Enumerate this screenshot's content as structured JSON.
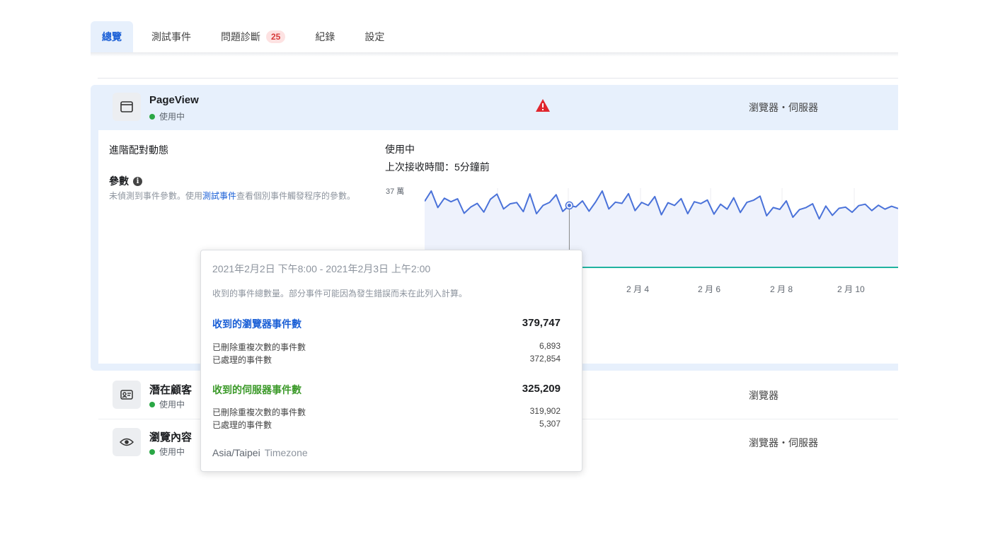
{
  "tabs": [
    {
      "label": "總覽",
      "active": true
    },
    {
      "label": "測試事件",
      "active": false
    },
    {
      "label": "問題診斷",
      "active": false,
      "badge": "25"
    },
    {
      "label": "紀錄",
      "active": false
    },
    {
      "label": "設定",
      "active": false
    }
  ],
  "events": [
    {
      "name": "PageView",
      "status": "使用中",
      "sources": "瀏覽器・伺服器",
      "icon": "browser-window-icon",
      "warning": true
    },
    {
      "name": "潛在顧客",
      "status": "使用中",
      "sources": "瀏覽器",
      "icon": "contact-card-icon"
    },
    {
      "name": "瀏覽內容",
      "status": "使用中",
      "sources": "瀏覽器・伺服器",
      "icon": "eye-icon"
    }
  ],
  "details": {
    "matching_label": "進階配對動態",
    "params_label": "參數",
    "params_desc_prefix": "未偵測到事件參數。使用",
    "params_desc_link": "測試事件",
    "params_desc_suffix": "查看個別事件觸發程序的參數。"
  },
  "chart_header": {
    "status": "使用中",
    "last_received": "上次接收時間：5分鐘前"
  },
  "chart_data": {
    "type": "line",
    "y_top_label": "37 萬",
    "x_tick_labels": [
      "2 月 4",
      "2 月 6",
      "2 月 8",
      "2 月 10"
    ],
    "ylim": [
      0,
      370000
    ],
    "series": [
      {
        "color": "#4a72d9",
        "values": [
          320000,
          370000,
          290000,
          335000,
          318000,
          332000,
          262000,
          292000,
          310000,
          268000,
          330000,
          355000,
          283000,
          308000,
          314000,
          270000,
          356000,
          260000,
          300000,
          315000,
          352000,
          271000,
          300000,
          293000,
          322000,
          272000,
          317000,
          370000,
          283000,
          316000,
          310000,
          357000,
          275000,
          315000,
          300000,
          343000,
          255000,
          313000,
          300000,
          333000,
          260000,
          318000,
          309000,
          326000,
          258000,
          306000,
          282000,
          337000,
          266000,
          315000,
          325000,
          345000,
          250000,
          290000,
          281000,
          322000,
          243000,
          280000,
          290000,
          308000,
          235000,
          297000,
          252000,
          286000,
          292000,
          267000,
          299000,
          306000,
          275000,
          301000,
          282000,
          296000,
          285000
        ]
      },
      {
        "color": "#20b3a0",
        "values": [
          0,
          0,
          0,
          0,
          0,
          0,
          0,
          0,
          0,
          0,
          0,
          0,
          0,
          0,
          0,
          0,
          0,
          0,
          0,
          0,
          0,
          0,
          0,
          0,
          0,
          0,
          0,
          0,
          0,
          0,
          0,
          0,
          0,
          0,
          0,
          0,
          0,
          0,
          0,
          0,
          0,
          0,
          0,
          0,
          0,
          0,
          0,
          0,
          0,
          0,
          0,
          0,
          0,
          0,
          0,
          0,
          0,
          0,
          0,
          0,
          0,
          0,
          0,
          0,
          0,
          0,
          0,
          0,
          0,
          0,
          0,
          0,
          0
        ]
      }
    ],
    "highlight_index": 22
  },
  "tooltip": {
    "range": "2021年2月2日 下午8:00 - 2021年2月3日 上午2:00",
    "note": "收到的事件總數量。部分事件可能因為發生錯誤而未在此列入計算。",
    "browser": {
      "title": "收到的瀏覽器事件數",
      "title_color": "#1a5fd6",
      "total": "379,747",
      "dedup_label": "已刪除重複次數的事件數",
      "dedup_value": "6,893",
      "processed_label": "已處理的事件數",
      "processed_value": "372,854"
    },
    "server": {
      "title": "收到的伺服器事件數",
      "title_color": "#3c9a2a",
      "total": "325,209",
      "dedup_label": "已刪除重複次數的事件數",
      "dedup_value": "319,902",
      "processed_label": "已處理的事件數",
      "processed_value": "5,307"
    },
    "timezone": "Asia/Taipei",
    "timezone_word": "Timezone"
  }
}
